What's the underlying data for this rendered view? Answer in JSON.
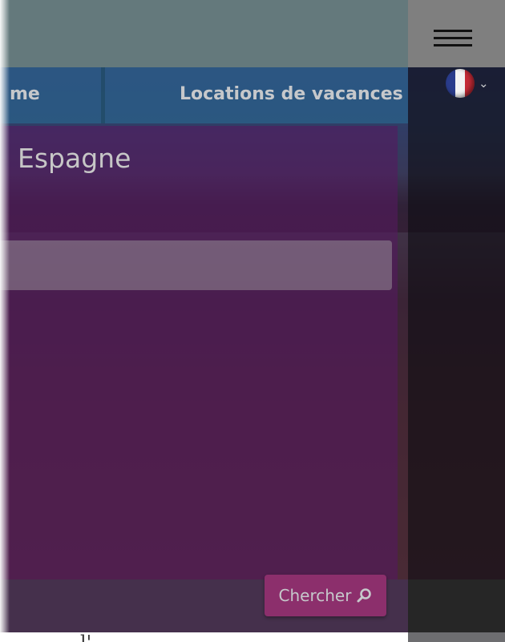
{
  "nav": {
    "left_partial_label": "me",
    "right_label": "Locations de vacances"
  },
  "language": {
    "current": "French",
    "flag_colors": [
      "#2a3c8c",
      "#f3f3f3",
      "#c42a36"
    ]
  },
  "search_panel": {
    "title": "Espagne",
    "input_value": "",
    "search_button_label": "Chercher",
    "search_button_color": "#8c2f6c"
  },
  "partial_text_below": "l'"
}
